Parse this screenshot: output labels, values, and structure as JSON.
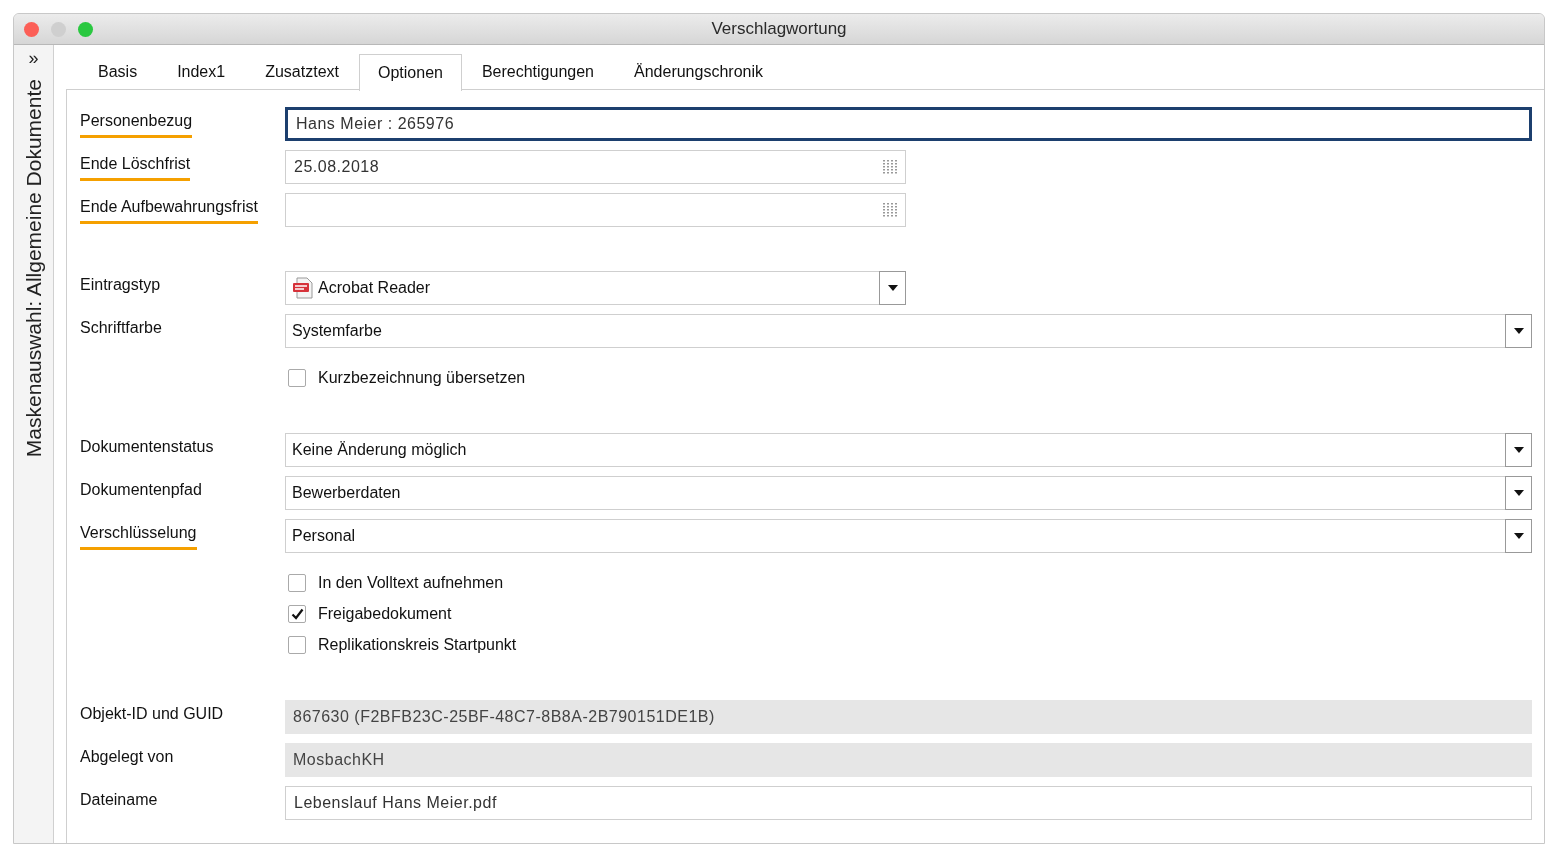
{
  "window": {
    "title": "Verschlagwortung"
  },
  "side_panel": {
    "expand_glyph": "»",
    "title": "Maskenauswahl: Allgemeine Dokumente"
  },
  "tabs": [
    {
      "label": "Basis",
      "selected": false
    },
    {
      "label": "Index1",
      "selected": false
    },
    {
      "label": "Zusatztext",
      "selected": false
    },
    {
      "label": "Optionen",
      "selected": true
    },
    {
      "label": "Berechtigungen",
      "selected": false
    },
    {
      "label": "Änderungschronik",
      "selected": false
    }
  ],
  "sections": [
    [
      {
        "kind": "text",
        "label": "Personenbezug",
        "required": true,
        "value": "Hans Meier : 265976",
        "focused": true
      },
      {
        "kind": "date",
        "label": "Ende Löschfrist",
        "required": true,
        "value": "25.08.2018"
      },
      {
        "kind": "date",
        "label": "Ende Aufbewahrungsfrist",
        "required": true
      }
    ],
    [
      {
        "kind": "type_select",
        "label": "Eintragstyp",
        "required": false,
        "value": "Acrobat Reader"
      },
      {
        "kind": "select",
        "label": "Schriftfarbe",
        "required": false,
        "value": "Systemfarbe"
      },
      {
        "kind": "checkbox",
        "text": "Kurzbezeichnung übersetzen",
        "checked": false
      }
    ],
    [
      {
        "kind": "select",
        "label": "Dokumentenstatus",
        "required": false,
        "value": "Keine Änderung möglich"
      },
      {
        "kind": "select",
        "label": "Dokumentenpfad",
        "required": false,
        "value": "Bewerberdaten"
      },
      {
        "kind": "select",
        "label": "Verschlüsselung",
        "required": true,
        "value": "Personal"
      },
      {
        "kind": "checkbox",
        "text": "In den Volltext aufnehmen",
        "checked": false
      },
      {
        "kind": "checkbox",
        "text": "Freigabedokument",
        "checked": true
      },
      {
        "kind": "checkbox",
        "text": "Replikationskreis Startpunkt",
        "checked": false
      }
    ],
    [
      {
        "kind": "readonly",
        "label": "Objekt-ID und GUID",
        "required": false,
        "value": "867630 (F2BFB23C-25BF-48C7-8B8A-2B790151DE1B)"
      },
      {
        "kind": "readonly",
        "label": "Abgelegt von",
        "required": false,
        "value": "MosbachKH"
      },
      {
        "kind": "text",
        "label": "Dateiname",
        "required": false,
        "value": "Lebenslauf Hans Meier.pdf",
        "focused": false
      }
    ]
  ]
}
